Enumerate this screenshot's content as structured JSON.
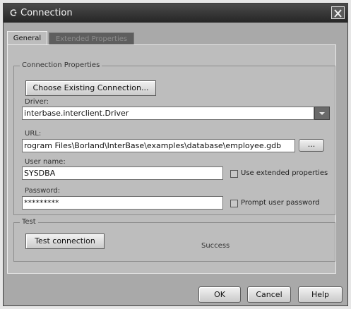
{
  "window": {
    "title": "Connection",
    "close_glyph": "✕"
  },
  "tabs": [
    {
      "label": "General",
      "selected": true
    },
    {
      "label": "Extended Properties",
      "selected": false
    }
  ],
  "connection_group": {
    "legend": "Connection Properties",
    "choose_button": "Choose Existing Connection...",
    "driver_label": "Driver:",
    "driver_value": "interbase.interclient.Driver",
    "url_label": "URL:",
    "url_value": "rogram Files\\Borland\\InterBase\\examples\\database\\employee.gdb",
    "url_browse": "...",
    "username_label": "User name:",
    "username_value": "SYSDBA",
    "password_label": "Password:",
    "password_value": "*********",
    "use_extended_label": "Use extended properties",
    "prompt_password_label": "Prompt user password"
  },
  "test_group": {
    "legend": "Test",
    "test_button": "Test connection",
    "status": "Success"
  },
  "buttons": {
    "ok": "OK",
    "cancel": "Cancel",
    "help": "Help"
  },
  "colors": {
    "titlebar": "#2c2c2c",
    "panel": "#bdbdbd",
    "window": "#a9a9a9"
  },
  "icons": {
    "title": "app-icon",
    "close": "close-icon",
    "dropdown": "chevron-down-icon"
  }
}
